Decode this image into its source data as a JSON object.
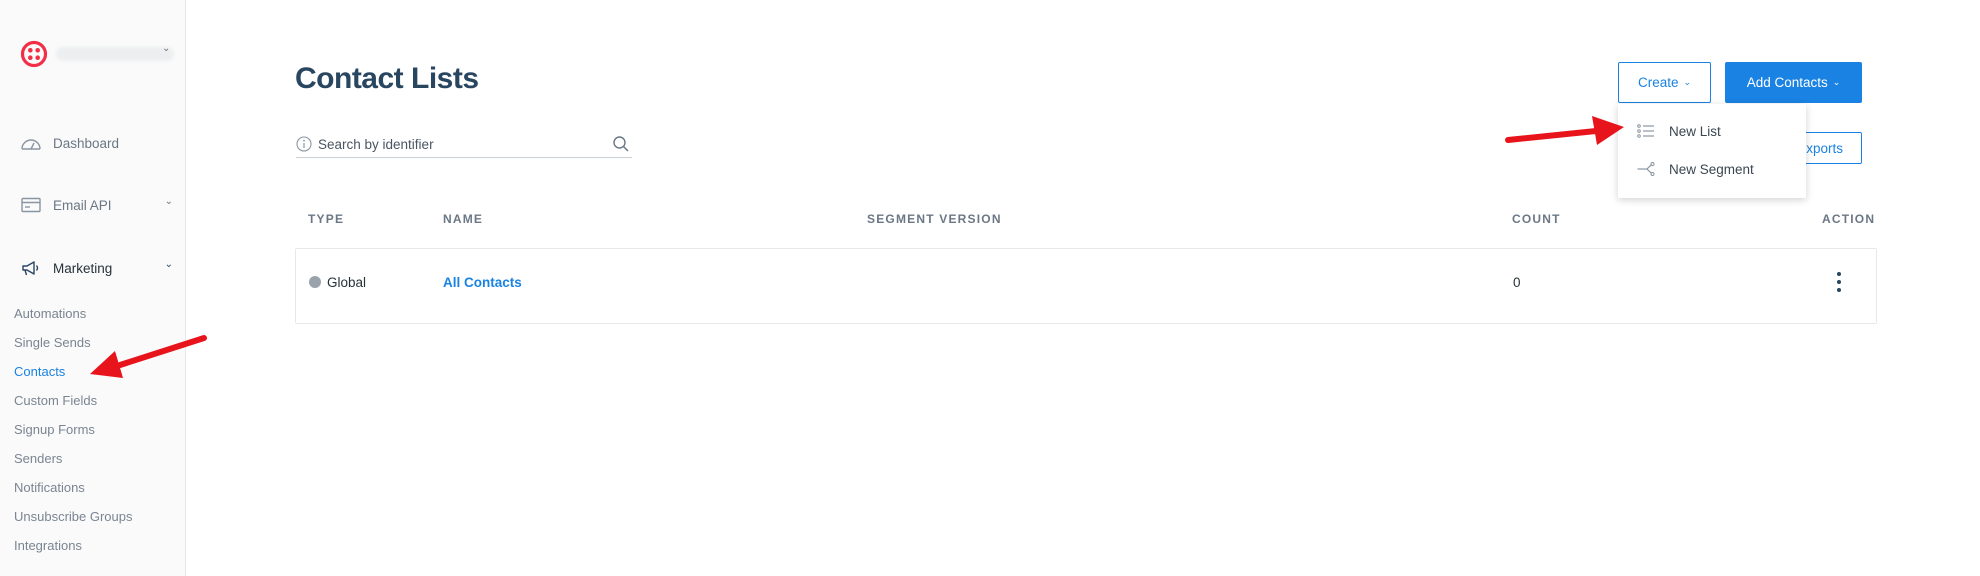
{
  "sidebar": {
    "brand": {
      "logo": "twilio-logo",
      "account_name_redacted": true
    },
    "nav": [
      {
        "label": "Dashboard",
        "icon": "gauge-icon"
      },
      {
        "label": "Email API",
        "icon": "email-api-icon"
      },
      {
        "label": "Marketing",
        "icon": "megaphone-icon"
      }
    ],
    "marketing_items": [
      {
        "label": "Automations"
      },
      {
        "label": "Single Sends"
      },
      {
        "label": "Contacts",
        "active": true
      },
      {
        "label": "Custom Fields"
      },
      {
        "label": "Signup Forms"
      },
      {
        "label": "Senders"
      },
      {
        "label": "Notifications"
      },
      {
        "label": "Unsubscribe Groups"
      },
      {
        "label": "Integrations"
      }
    ]
  },
  "main": {
    "title": "Contact Lists",
    "search": {
      "placeholder": "Search by identifier"
    },
    "buttons": {
      "create": "Create",
      "add_contacts": "Add Contacts",
      "exports": "xports"
    },
    "create_menu": [
      {
        "label": "New List",
        "icon": "list-icon"
      },
      {
        "label": "New Segment",
        "icon": "segment-icon"
      }
    ],
    "table": {
      "headers": {
        "type": "TYPE",
        "name": "NAME",
        "segment_version": "SEGMENT VERSION",
        "count": "COUNT",
        "action": "ACTION"
      },
      "rows": [
        {
          "type": "Global",
          "name": "All Contacts",
          "segment_version": "",
          "count": "0"
        }
      ]
    }
  },
  "colors": {
    "accent": "#1a82e2",
    "title": "#294661",
    "annotation_arrow": "#e8141b",
    "brand_red": "#f22f46"
  }
}
